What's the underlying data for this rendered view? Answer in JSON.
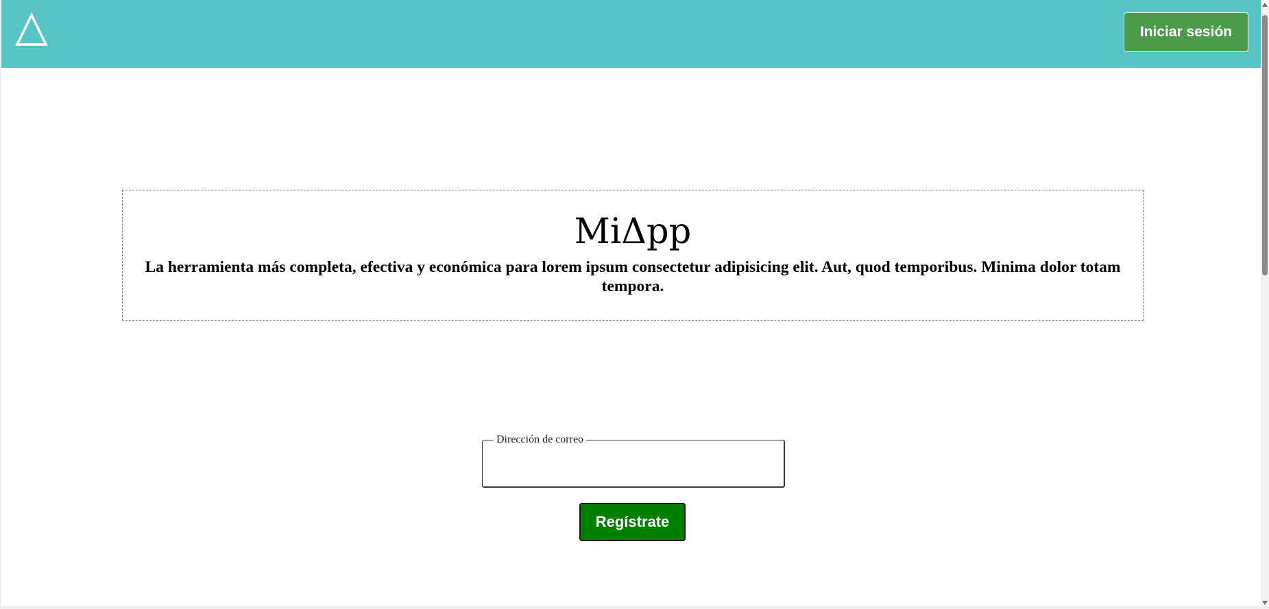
{
  "header": {
    "logo_icon": "triangle-delta-icon",
    "login_label": "Iniciar sesión",
    "background_color": "#56c3c5",
    "login_button_color": "#4a9b4a"
  },
  "hero": {
    "title": "MiΔpp",
    "tagline": "La herramienta más completa, efectiva y económica para lorem ipsum consectetur adipisicing elit. Aut, quod temporibus. Minima dolor totam tempora."
  },
  "signup": {
    "email_legend": "Dirección de correo",
    "email_value": "",
    "button_label": "Regístrate",
    "button_color": "#008000"
  }
}
